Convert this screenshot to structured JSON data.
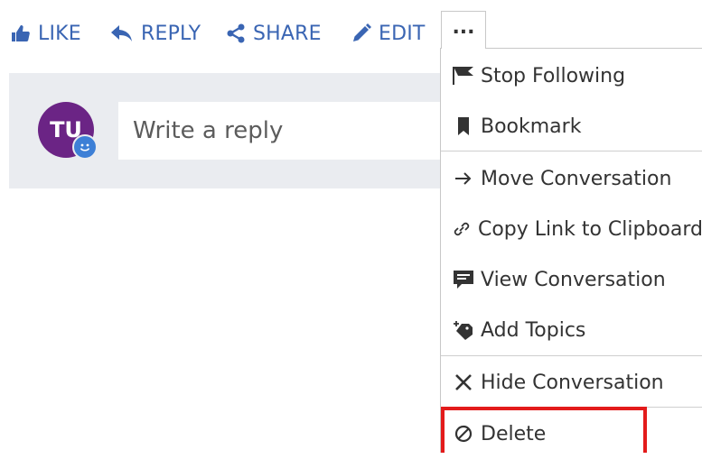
{
  "toolbar": {
    "like_label": "LIKE",
    "reply_label": "REPLY",
    "share_label": "SHARE",
    "edit_label": "EDIT",
    "more_label": "..."
  },
  "reply_box": {
    "avatar_initials": "TU",
    "placeholder": "Write a reply"
  },
  "menu": {
    "items": [
      {
        "label": "Stop Following",
        "icon": "flag-icon"
      },
      {
        "label": "Bookmark",
        "icon": "bookmark-icon"
      },
      {
        "label": "Move Conversation",
        "icon": "arrow-right-icon"
      },
      {
        "label": "Copy Link to Clipboard",
        "icon": "link-icon"
      },
      {
        "label": "View Conversation",
        "icon": "chat-box-icon"
      },
      {
        "label": "Add Topics",
        "icon": "tag-plus-icon"
      },
      {
        "label": "Hide Conversation",
        "icon": "close-x-icon"
      },
      {
        "label": "Delete",
        "icon": "prohibited-icon"
      }
    ]
  },
  "colors": {
    "accent": "#3a65b3",
    "avatar_bg": "#6b2485",
    "highlight": "#e31b1b",
    "reply_bg": "#eaecf0"
  }
}
